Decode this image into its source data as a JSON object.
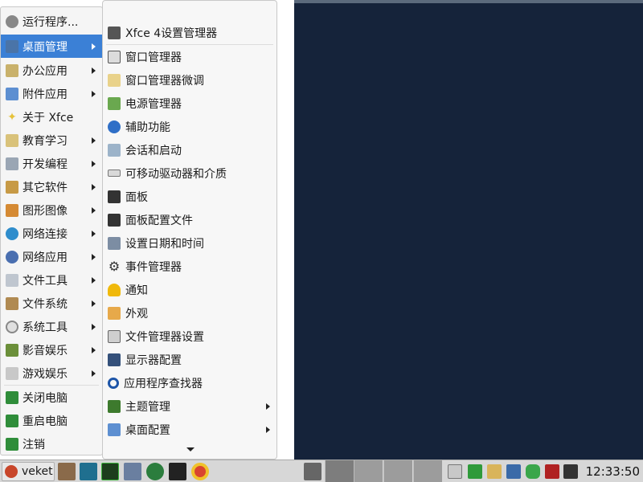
{
  "main_menu": {
    "items": [
      {
        "label": "运行程序...",
        "icon": "run-icon",
        "submenu": false
      },
      {
        "label": "桌面管理",
        "icon": "desktop-settings-icon",
        "submenu": true,
        "active": true
      },
      {
        "label": "办公应用",
        "icon": "office-icon",
        "submenu": true
      },
      {
        "label": "附件应用",
        "icon": "accessories-icon",
        "submenu": true
      },
      {
        "label": "关于 Xfce",
        "icon": "about-star-icon",
        "submenu": false
      },
      {
        "label": "教育学习",
        "icon": "education-icon",
        "submenu": true
      },
      {
        "label": "开发编程",
        "icon": "development-icon",
        "submenu": true
      },
      {
        "label": "其它软件",
        "icon": "other-icon",
        "submenu": true
      },
      {
        "label": "图形图像",
        "icon": "graphics-icon",
        "submenu": true
      },
      {
        "label": "网络连接",
        "icon": "network-icon",
        "submenu": true
      },
      {
        "label": "网络应用",
        "icon": "internet-icon",
        "submenu": true
      },
      {
        "label": "文件工具",
        "icon": "file-tools-icon",
        "submenu": true
      },
      {
        "label": "文件系统",
        "icon": "filesystem-icon",
        "submenu": true
      },
      {
        "label": "系统工具",
        "icon": "system-tools-icon",
        "submenu": true
      },
      {
        "label": "影音娱乐",
        "icon": "multimedia-icon",
        "submenu": true
      },
      {
        "label": "游戏娱乐",
        "icon": "games-icon",
        "submenu": true
      },
      {
        "label": "关闭电脑",
        "icon": "shutdown-icon",
        "submenu": false
      },
      {
        "label": "重启电脑",
        "icon": "reboot-icon",
        "submenu": false
      },
      {
        "label": "注销",
        "icon": "logout-icon",
        "submenu": false
      }
    ]
  },
  "submenu": {
    "items": [
      {
        "label": "Xfce 4设置管理器",
        "icon": "settings-manager-icon",
        "submenu": false
      },
      {
        "label": "窗口管理器",
        "icon": "window-manager-icon",
        "submenu": false
      },
      {
        "label": "窗口管理器微调",
        "icon": "window-tweaks-icon",
        "submenu": false
      },
      {
        "label": "电源管理器",
        "icon": "power-manager-icon",
        "submenu": false
      },
      {
        "label": "辅助功能",
        "icon": "accessibility-icon",
        "submenu": false
      },
      {
        "label": "会话和启动",
        "icon": "session-icon",
        "submenu": false
      },
      {
        "label": "可移动驱动器和介质",
        "icon": "removable-drive-icon",
        "submenu": false
      },
      {
        "label": "面板",
        "icon": "panel-icon",
        "submenu": false
      },
      {
        "label": "面板配置文件",
        "icon": "panel-profiles-icon",
        "submenu": false
      },
      {
        "label": "设置日期和时间",
        "icon": "calendar-icon",
        "submenu": false
      },
      {
        "label": "事件管理器",
        "icon": "gear-icon",
        "submenu": false
      },
      {
        "label": "通知",
        "icon": "bell-icon",
        "submenu": false
      },
      {
        "label": "外观",
        "icon": "appearance-icon",
        "submenu": false
      },
      {
        "label": "文件管理器设置",
        "icon": "file-manager-settings-icon",
        "submenu": false
      },
      {
        "label": "显示器配置",
        "icon": "display-icon",
        "submenu": false
      },
      {
        "label": "应用程序查找器",
        "icon": "search-icon",
        "submenu": false
      },
      {
        "label": "主题管理",
        "icon": "theme-icon",
        "submenu": true
      },
      {
        "label": "桌面配置",
        "icon": "desktop-config-icon",
        "submenu": true
      }
    ]
  },
  "taskbar": {
    "start_label": "veket",
    "clock": "12:33:50"
  }
}
